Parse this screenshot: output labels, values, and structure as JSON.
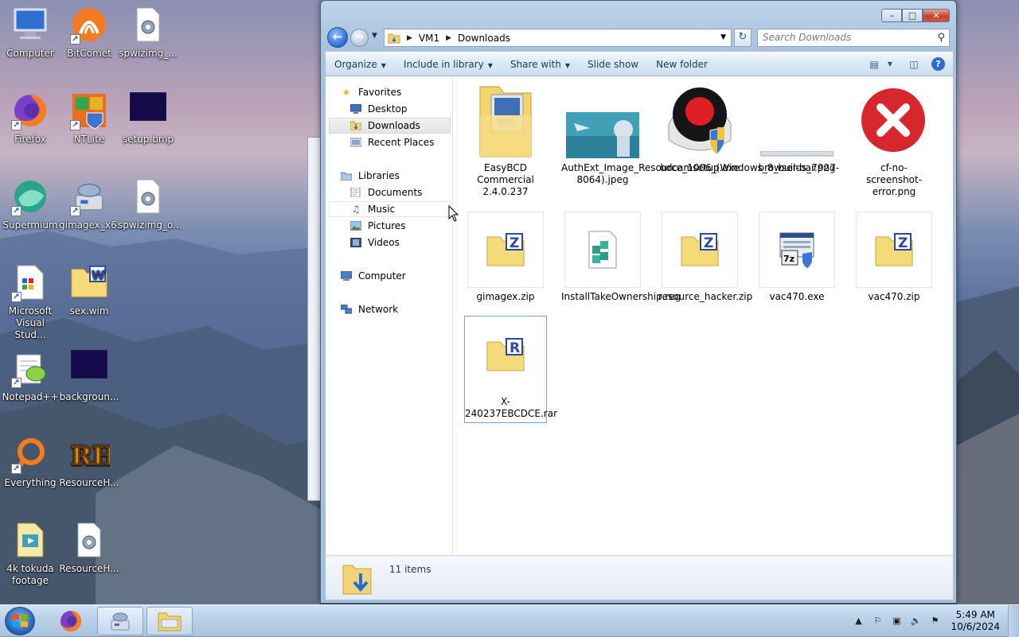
{
  "desktop": {
    "icons": [
      {
        "label": "Computer",
        "icon": "computer-icon",
        "shortcut": false
      },
      {
        "label": "BitComet",
        "icon": "bitcomet-icon",
        "shortcut": true
      },
      {
        "label": "spwizimg_...",
        "icon": "settings-file-icon",
        "shortcut": false
      },
      {
        "label": "Firefox",
        "icon": "firefox-icon",
        "shortcut": true
      },
      {
        "label": "NTLite",
        "icon": "ntlite-icon",
        "shortcut": true
      },
      {
        "label": "setup.bmp",
        "icon": "bitmap-icon",
        "shortcut": false
      },
      {
        "label": "Supermium",
        "icon": "supermium-icon",
        "shortcut": true
      },
      {
        "label": "gimagex_x6...",
        "icon": "gimagex-icon",
        "shortcut": true
      },
      {
        "label": "spwizimg_o...",
        "icon": "settings-file-icon",
        "shortcut": false
      },
      {
        "label": "Microsoft Visual Stud...",
        "icon": "visual-studio-icon",
        "shortcut": true
      },
      {
        "label": "sex.wim",
        "icon": "wim-file-icon",
        "shortcut": false
      },
      {
        "label": "Notepad++",
        "icon": "notepad-plus-plus-icon",
        "shortcut": true
      },
      {
        "label": "backgroun...",
        "icon": "bitmap-icon",
        "shortcut": false
      },
      {
        "label": "Everything",
        "icon": "everything-search-icon",
        "shortcut": true
      },
      {
        "label": "ResourceH...",
        "icon": "resource-hacker-icon",
        "shortcut": false
      },
      {
        "label": "4k tokuda footage",
        "icon": "video-file-icon",
        "shortcut": false
      },
      {
        "label": "ResourceH...",
        "icon": "settings-file-icon",
        "shortcut": false
      }
    ]
  },
  "explorer": {
    "address": {
      "root": "VM1",
      "current": "Downloads"
    },
    "search_placeholder": "Search Downloads",
    "toolbar": {
      "organize": "Organize",
      "include": "Include in library",
      "share": "Share with",
      "slideshow": "Slide show",
      "new_folder": "New folder"
    },
    "nav": {
      "favorites": "Favorites",
      "desktop": "Desktop",
      "downloads": "Downloads",
      "recent": "Recent Places",
      "libraries": "Libraries",
      "documents": "Documents",
      "music": "Music",
      "pictures": "Pictures",
      "videos": "Videos",
      "computer": "Computer",
      "network": "Network"
    },
    "files": [
      {
        "name": "EasyBCD Commercial 2.4.0.237",
        "type": "folder"
      },
      {
        "name": "AuthExt_Image_Resource_1006_(Windows_8_builds_7927-8064).jpeg",
        "type": "jpeg"
      },
      {
        "name": "bdcamsetup.exe",
        "type": "exe"
      },
      {
        "name": "browser-bar.png",
        "type": "png"
      },
      {
        "name": "cf-no-screenshot-error.png",
        "type": "png"
      },
      {
        "name": "gimagex.zip",
        "type": "zip"
      },
      {
        "name": "InstallTakeOwnership.reg",
        "type": "reg"
      },
      {
        "name": "resource_hacker.zip",
        "type": "zip"
      },
      {
        "name": "vac470.exe",
        "type": "exe"
      },
      {
        "name": "vac470.zip",
        "type": "zip"
      },
      {
        "name": "X-240237EBCDCE.rar",
        "type": "rar"
      }
    ],
    "file_labels": {
      "f0": "EasyBCD Commercial 2.4.0.237",
      "f1": "AuthExt_Image_Resource_1006_(Windows_8_builds_7927-8064).jpeg",
      "f2": "bdcamsetup.exe",
      "f3": "browser-bar.png",
      "f4": "cf-no-screenshot-error.png",
      "f5": "gimagex.zip",
      "f6": "InstallTakeOwnership.reg",
      "f7": "resource_hacker.zip",
      "f8": "vac470.exe",
      "f9": "vac470.zip",
      "f10": "X-240237EBCDCE.rar"
    },
    "status": {
      "count": "11 items"
    }
  },
  "taskbar": {
    "time": "5:49 AM",
    "date": "10/6/2024"
  },
  "colors": {
    "accent": "#2a6bd6",
    "taskbar": "#b7cfe8",
    "error_red": "#d7262c"
  }
}
